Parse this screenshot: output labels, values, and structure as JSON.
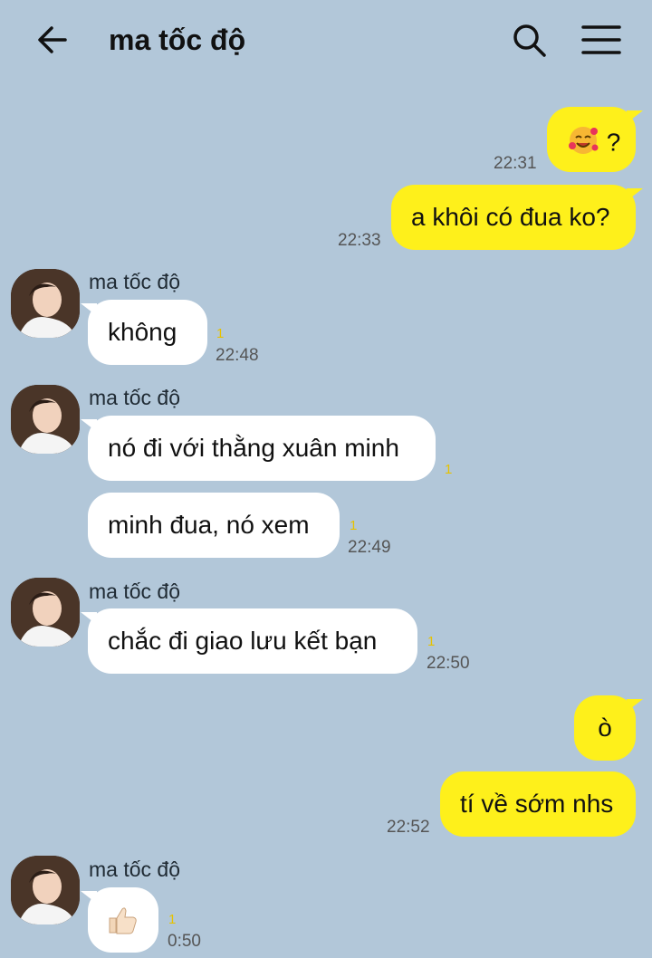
{
  "header": {
    "title": "ma tốc độ"
  },
  "messages": {
    "m1": {
      "text": "?",
      "time": "22:31"
    },
    "m2": {
      "text": "a khôi có đua ko?",
      "time": "22:33"
    },
    "g1": {
      "sender": "ma tốc độ",
      "text": "không",
      "unread": "1",
      "time": "22:48"
    },
    "g2": {
      "sender": "ma tốc độ",
      "text": "nó đi với thằng xuân minh",
      "unread": "1"
    },
    "g2b": {
      "text": "minh đua, nó xem",
      "unread": "1",
      "time": "22:49"
    },
    "g3": {
      "sender": "ma tốc độ",
      "text": "chắc đi giao lưu kết bạn",
      "unread": "1",
      "time": "22:50"
    },
    "m3": {
      "text": "ò"
    },
    "m4": {
      "text": "tí về sớm nhs",
      "time": "22:52"
    },
    "g4": {
      "sender": "ma tốc độ",
      "unread": "1",
      "time": "0:50"
    }
  }
}
